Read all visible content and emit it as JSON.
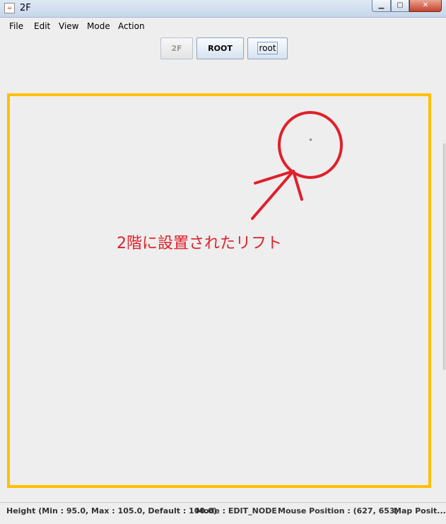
{
  "window": {
    "title": "2F",
    "minimize_glyph": "▁",
    "maximize_glyph": "▢",
    "close_glyph": "✕"
  },
  "menu": [
    "File",
    "Edit",
    "View",
    "Mode",
    "Action"
  ],
  "toolbar": {
    "floor_label": "2F",
    "root_label": "ROOT",
    "root2_label": "root"
  },
  "annotation": {
    "text": "2階に設置されたリフト",
    "color": "#e0202a"
  },
  "map": {
    "border_color": "#ffc000"
  },
  "status": {
    "height": "Height (Min : 95.0, Max : 105.0, Default : 100.0)",
    "mode": "Mode : EDIT_NODE",
    "mouse": "Mouse Position : (627, 653)",
    "map_position": "Map Posit..."
  }
}
